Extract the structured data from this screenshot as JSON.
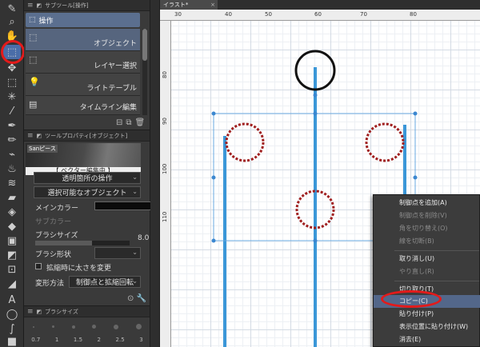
{
  "subtool_panel": {
    "title": "サブツール[操作]",
    "group": "操作",
    "items": [
      {
        "label": "オブジェクト",
        "icon": "object-select-icon",
        "selected": true
      },
      {
        "label": "レイヤー選択",
        "icon": "layer-select-icon",
        "selected": false
      },
      {
        "label": "ライトテーブル",
        "icon": "light-table-icon",
        "selected": false
      },
      {
        "label": "タイムライン編集",
        "icon": "timeline-icon",
        "selected": false
      }
    ]
  },
  "tool_property": {
    "title": "ツールプロパティ[オブジェクト]",
    "preview_tag": "Sanピース",
    "vector_label": "【 ベクター編集中 】",
    "transparent_op": "透明箇所の操作",
    "selectable_object": "選択可能なオブジェクト",
    "main_color_label": "メインカラー",
    "sub_color_label": "サブカラー",
    "brush_size_label": "ブラシサイズ",
    "brush_size_value": "8.0",
    "brush_shape_label": "ブラシ形状",
    "scale_thickness_label": "拡縮時に太さを変更",
    "transform_method_label": "変形方法",
    "transform_method_value": "制御点と拡縮回転",
    "main_color": "#0b0b0b"
  },
  "brush_size_panel": {
    "title": "ブラシサイズ",
    "values": [
      "0.7",
      "1",
      "1.5",
      "2",
      "2.5",
      "3"
    ]
  },
  "canvas": {
    "tab_label": "イラスト*",
    "ruler_top": [
      "30",
      "40",
      "50",
      "60",
      "70",
      "80"
    ],
    "ruler_left": [
      "80",
      "90",
      "100",
      "110"
    ]
  },
  "context_menu": {
    "items": [
      {
        "label": "制御点を追加(A)",
        "disabled": false,
        "highlight": false
      },
      {
        "label": "制御点を削除(V)",
        "disabled": true,
        "highlight": false
      },
      {
        "label": "角を切り替え(O)",
        "disabled": true,
        "highlight": false
      },
      {
        "label": "線を切断(B)",
        "disabled": true,
        "highlight": false
      },
      {
        "label": "取り消し(U)",
        "disabled": false,
        "highlight": false
      },
      {
        "label": "やり直し(R)",
        "disabled": true,
        "highlight": false
      },
      {
        "label": "切り取り(T)",
        "disabled": false,
        "highlight": false
      },
      {
        "label": "コピー(C)",
        "disabled": false,
        "highlight": true
      },
      {
        "label": "貼り付け(P)",
        "disabled": false,
        "highlight": false
      },
      {
        "label": "表示位置に貼り付け(W)",
        "disabled": false,
        "highlight": false
      },
      {
        "label": "消去(E)",
        "disabled": false,
        "highlight": false
      }
    ]
  },
  "colors": {
    "accent": "#53678a",
    "stroke_blue": "#3b97d8",
    "highlight_red": "#e31a1a",
    "circle_red": "#a02020"
  }
}
